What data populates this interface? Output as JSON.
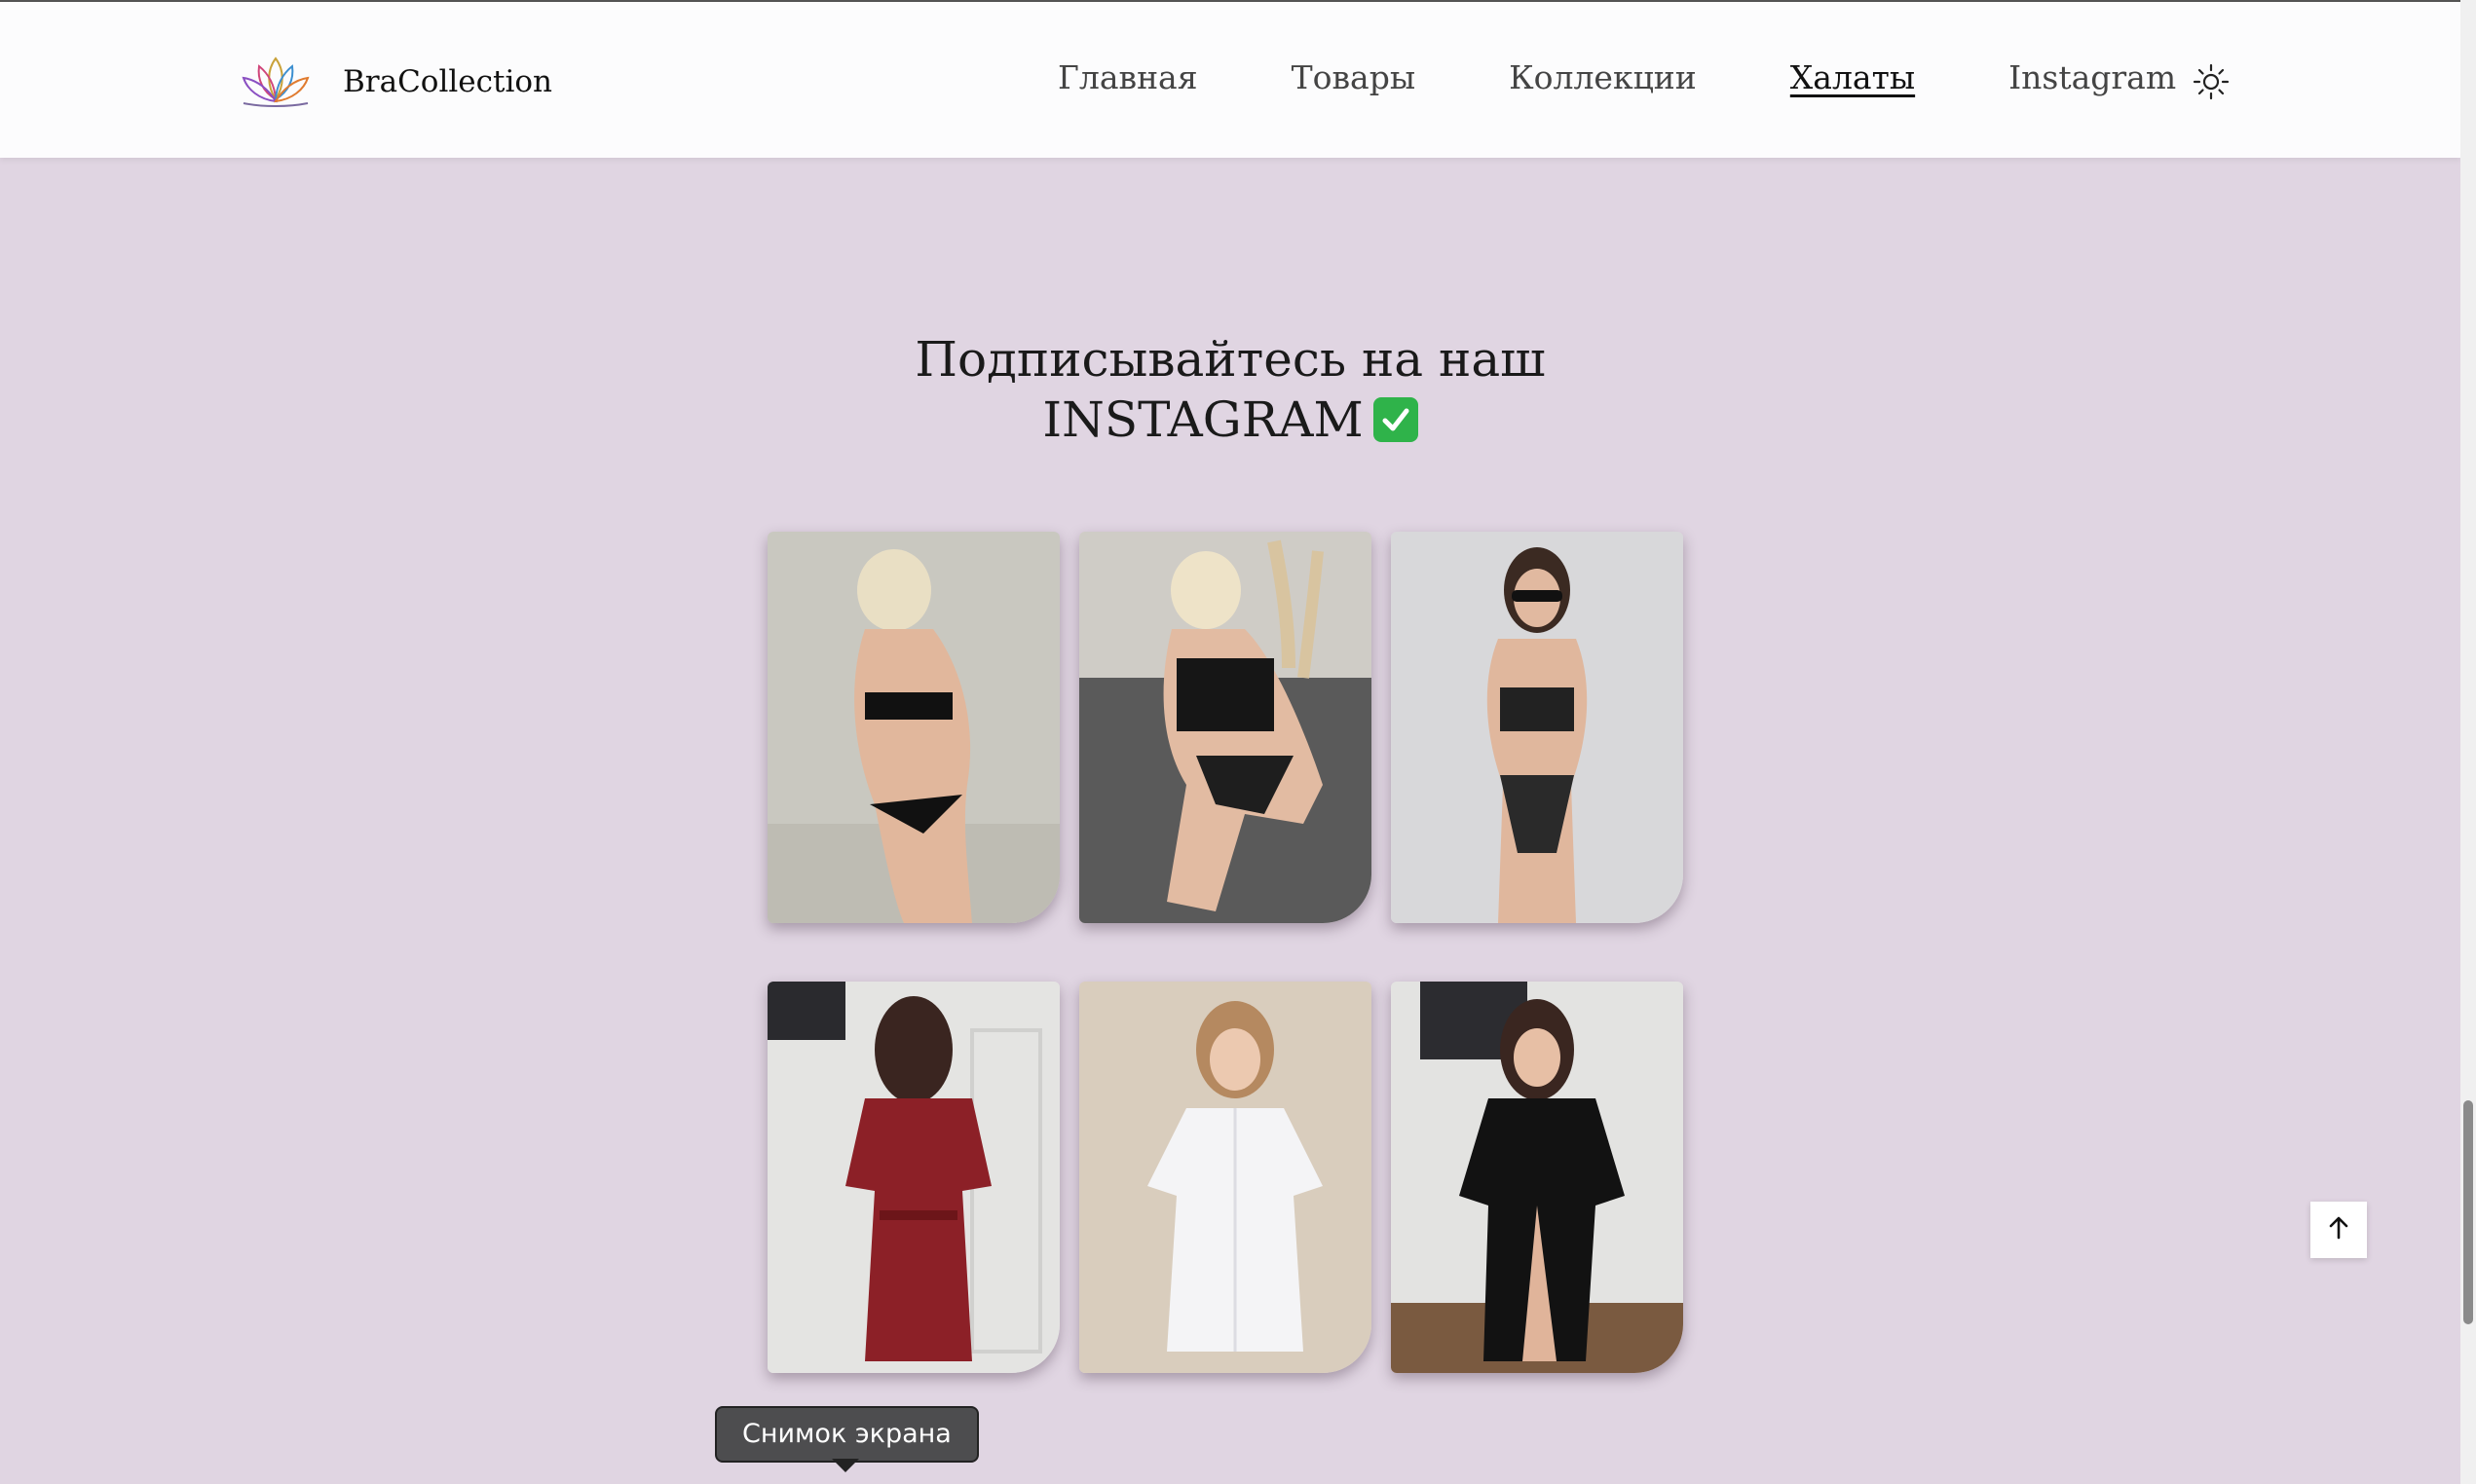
{
  "header": {
    "brand_name": "BraCollection",
    "logo_icon": "lotus-logo-icon",
    "nav": [
      {
        "label": "Главная",
        "active": false
      },
      {
        "label": "Товары",
        "active": false
      },
      {
        "label": "Коллекции",
        "active": false
      },
      {
        "label": "Халаты",
        "active": true
      },
      {
        "label": "Instagram",
        "active": false
      }
    ],
    "theme_toggle_icon": "sun-icon"
  },
  "section": {
    "title_line1": "Подписывайтесь на наш",
    "title_line2": "INSTAGRAM",
    "title_emoji": "check-mark-button-icon"
  },
  "gallery": {
    "photos": [
      {
        "name": "lingerie-photo-1",
        "alt": "Модель в чёрном белье, вид со спины"
      },
      {
        "name": "lingerie-photo-2",
        "alt": "Модель в чёрном белье на сером диване"
      },
      {
        "name": "lingerie-photo-3",
        "alt": "Модель в чёрном прозрачном белье и очках"
      },
      {
        "name": "robe-photo-1",
        "alt": "Модель в бордовом атласном халате"
      },
      {
        "name": "robe-photo-2",
        "alt": "Модель в белом атласном халате"
      },
      {
        "name": "robe-photo-3",
        "alt": "Модель в чёрном атласном халате"
      }
    ]
  },
  "scroll_to_top_icon": "arrow-up-icon",
  "tooltip": {
    "text": "Снимок экрана"
  },
  "colors": {
    "page_bg": "#e0d5e2",
    "navbar_bg": "#fcfcfd",
    "text": "#1a1a1a",
    "check_green": "#2fb34a",
    "tooltip_bg": "#4d4d4f"
  }
}
